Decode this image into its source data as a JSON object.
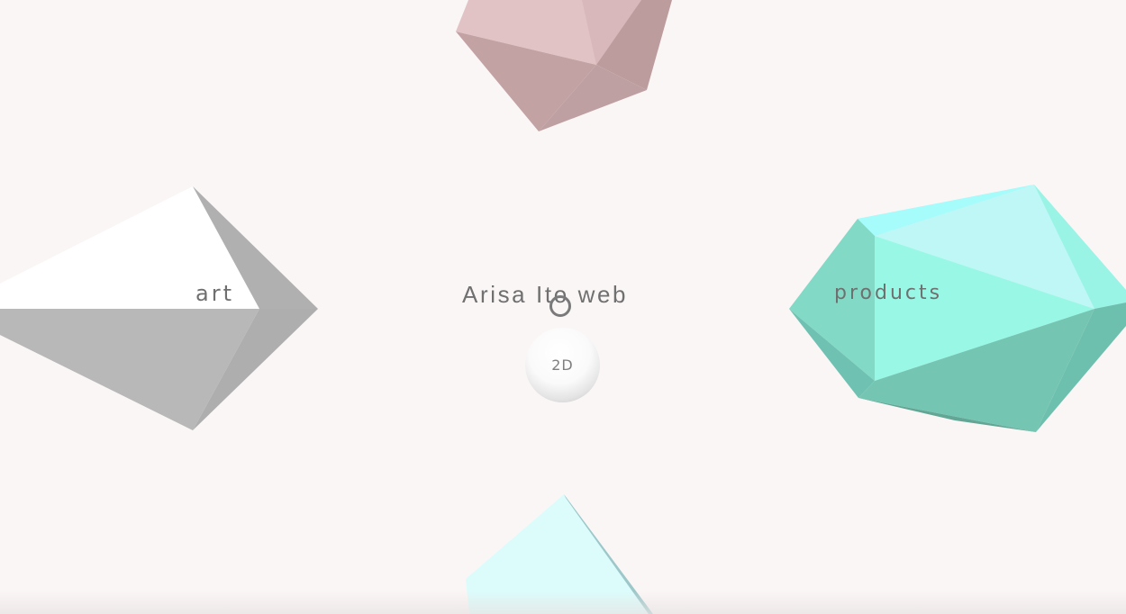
{
  "site": {
    "title": "Arisa Ito web"
  },
  "nav": {
    "art_label": "art",
    "products_label": "products"
  },
  "toggle": {
    "label": "2D"
  },
  "colors": {
    "background": "#fbf6f6",
    "art_shape": "#bdbdbd",
    "products_shape": "#79d2bd",
    "top_shape": "#c9a9aa",
    "bottom_shape": "#dcfafa",
    "text": "#707070"
  },
  "icons": {
    "cursor": "ring-cursor-icon"
  }
}
